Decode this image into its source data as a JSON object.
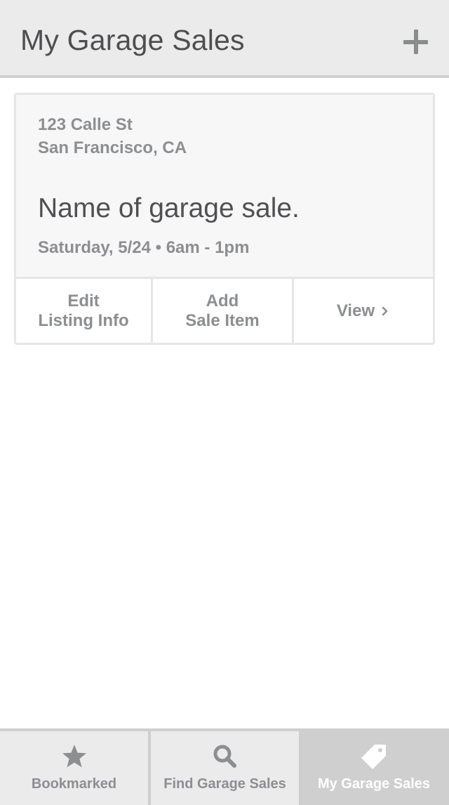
{
  "header": {
    "title": "My Garage Sales",
    "add_icon": "plus-icon"
  },
  "listing": {
    "address_line_1": "123 Calle St",
    "address_line_2": "San Francisco, CA",
    "name": "Name of garage sale.",
    "when": "Saturday, 5/24 • 6am - 1pm",
    "actions": {
      "edit_line_1": "Edit",
      "edit_line_2": "Listing Info",
      "add_line_1": "Add",
      "add_line_2": "Sale Item",
      "view": "View",
      "view_icon": "chevron-right-icon"
    }
  },
  "tabbar": {
    "tabs": [
      {
        "label": "Bookmarked",
        "icon": "star-icon",
        "active": false
      },
      {
        "label": "Find Garage Sales",
        "icon": "search-icon",
        "active": false
      },
      {
        "label": "My Garage Sales",
        "icon": "tag-icon",
        "active": true
      }
    ]
  },
  "colors": {
    "header_bg": "#ebebeb",
    "divider": "#cfcfcf",
    "card_bg": "#f7f7f7",
    "card_border": "#e6e6e6",
    "text_dark": "#505053",
    "text_muted": "#8d8e91",
    "active_tab_bg": "#cfcfcf",
    "active_tab_text": "#ffffff"
  }
}
